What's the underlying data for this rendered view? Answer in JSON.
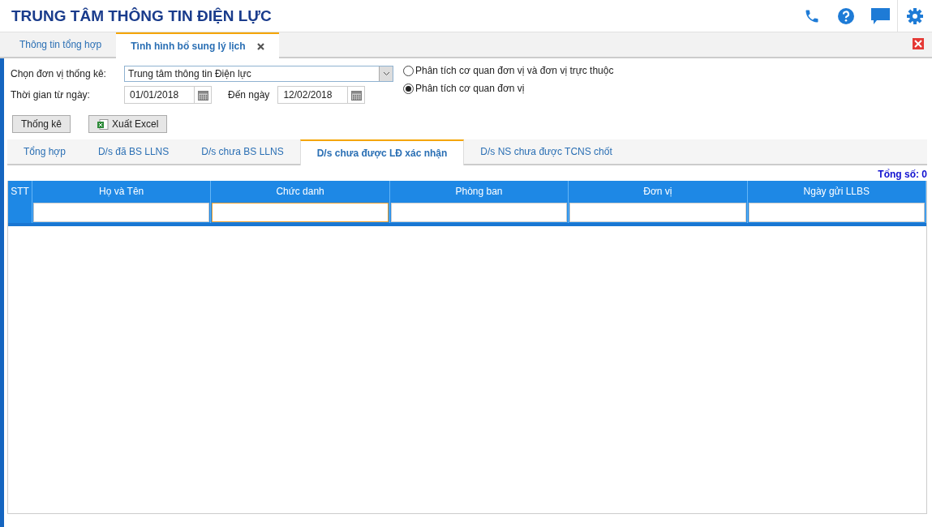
{
  "header": {
    "title": "TRUNG TÂM THÔNG TIN ĐIỆN LỰC"
  },
  "main_tabs": [
    {
      "label": "Thông tin tổng hợp",
      "selected": false,
      "closable": false
    },
    {
      "label": "Tình hình bổ sung lý lịch",
      "selected": true,
      "closable": true
    }
  ],
  "form": {
    "unit_label": "Chọn đơn vị thống kê:",
    "unit_value": "Trung tâm thông tin Điện lực",
    "from_label": "Thời gian từ ngày:",
    "from_value": "01/01/2018",
    "to_label": "Đến ngày",
    "to_value": "12/02/2018",
    "radios": [
      {
        "label": "Phân tích cơ quan đơn vị và đơn vị trực thuộc",
        "selected": false
      },
      {
        "label": "Phân tích cơ quan đơn vị",
        "selected": true
      }
    ],
    "buttons": [
      {
        "label": "Thống kê",
        "kind": "plain"
      },
      {
        "label": "Xuất Excel",
        "kind": "excel"
      }
    ]
  },
  "sub_tabs": [
    {
      "label": "Tổng hợp",
      "selected": false
    },
    {
      "label": "D/s đã BS LLNS",
      "selected": false
    },
    {
      "label": "D/s chưa BS LLNS",
      "selected": false
    },
    {
      "label": "D/s chưa được LĐ xác nhận",
      "selected": true
    },
    {
      "label": "D/s NS chưa được TCNS chốt",
      "selected": false
    }
  ],
  "total": "Tổng số: 0",
  "table": {
    "columns": [
      "STT",
      "Họ và Tên",
      "Chức danh",
      "Phòng ban",
      "Đơn vị",
      "Ngày gửi LLBS"
    ],
    "filters": [
      {
        "focused": false
      },
      {
        "focused": true
      },
      {
        "focused": false
      },
      {
        "focused": false
      },
      {
        "focused": false
      }
    ]
  }
}
